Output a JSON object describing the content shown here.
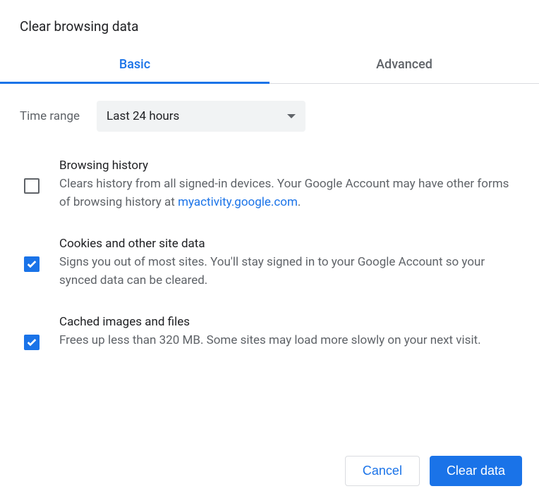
{
  "dialog": {
    "title": "Clear browsing data"
  },
  "tabs": {
    "basic": "Basic",
    "advanced": "Advanced",
    "active": "basic"
  },
  "time_range": {
    "label": "Time range",
    "selected": "Last 24 hours"
  },
  "options": [
    {
      "id": "browsing-history",
      "checked": false,
      "title": "Browsing history",
      "desc_pre": "Clears history from all signed-in devices. Your Google Account may have other forms of browsing history at ",
      "link_text": "myactivity.google.com",
      "desc_post": "."
    },
    {
      "id": "cookies",
      "checked": true,
      "title": "Cookies and other site data",
      "desc": "Signs you out of most sites. You'll stay signed in to your Google Account so your synced data can be cleared."
    },
    {
      "id": "cache",
      "checked": true,
      "title": "Cached images and files",
      "desc": "Frees up less than 320 MB. Some sites may load more slowly on your next visit."
    }
  ],
  "footer": {
    "cancel": "Cancel",
    "clear": "Clear data"
  },
  "colors": {
    "accent": "#1a73e8",
    "text_secondary": "#5f6368",
    "divider": "#dadce0",
    "dropdown_bg": "#f1f3f4"
  }
}
